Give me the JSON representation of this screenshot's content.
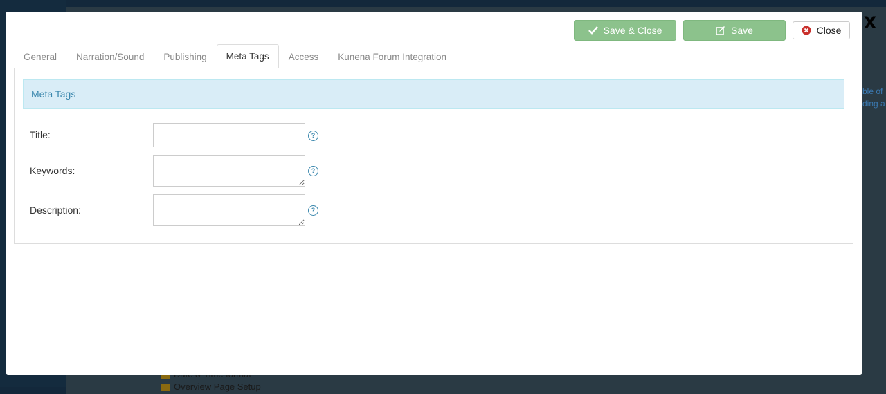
{
  "background": {
    "rows": [
      "Date & Time format",
      "Overview Page Setup"
    ],
    "side_text": [
      "ble of",
      "ding a"
    ]
  },
  "modal": {
    "close_x": "X",
    "toolbar": {
      "save_close_label": "Save & Close",
      "save_label": "Save",
      "close_label": "Close"
    },
    "tabs": [
      "General",
      "Narration/Sound",
      "Publishing",
      "Meta Tags",
      "Access",
      "Kunena Forum Integration"
    ],
    "active_tab": "Meta Tags",
    "section_title": "Meta Tags",
    "fields": {
      "title": {
        "label": "Title:",
        "value": ""
      },
      "keywords": {
        "label": "Keywords:",
        "value": ""
      },
      "description": {
        "label": "Description:",
        "value": ""
      },
      "help_glyph": "?"
    },
    "colors": {
      "save_button": "#8cc28c",
      "section_header_bg": "#d9edf7",
      "section_header_text": "#3a87ad",
      "close_icon": "#c9302c"
    }
  }
}
